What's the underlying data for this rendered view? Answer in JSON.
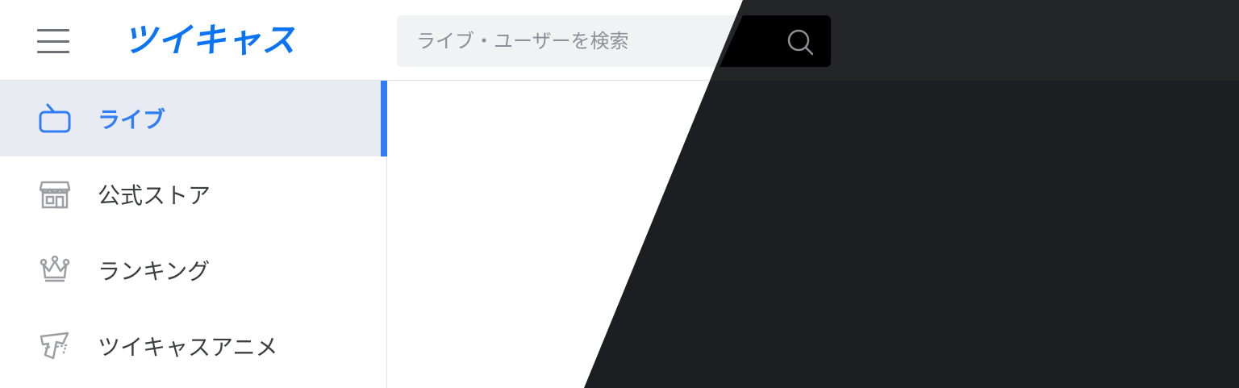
{
  "header": {
    "logo_text": "ツイキャス",
    "search_placeholder": "ライブ・ユーザーを検索"
  },
  "sidebar": {
    "items": [
      {
        "label": "ライブ",
        "icon": "tv-icon",
        "active": true
      },
      {
        "label": "公式ストア",
        "icon": "store-icon",
        "active": false
      },
      {
        "label": "ランキング",
        "icon": "crown-icon",
        "active": false
      },
      {
        "label": "ツイキャスアニメ",
        "icon": "anime-icon",
        "active": false
      }
    ]
  },
  "colors": {
    "brand": "#0a74f5",
    "active_accent": "#2f7ef6",
    "active_bg": "#e9ebf3",
    "dark_panel": "#1d1e21"
  }
}
